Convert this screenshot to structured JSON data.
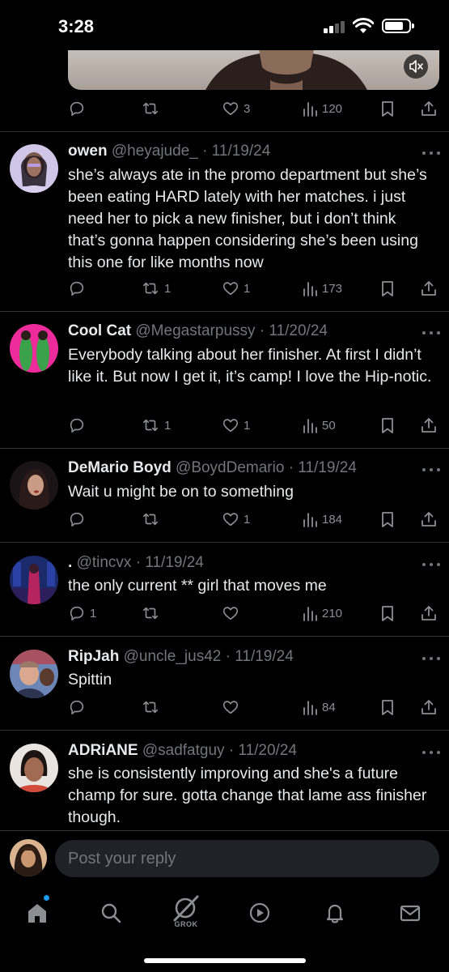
{
  "status_bar": {
    "time": "3:28"
  },
  "top_tweet": {
    "likes": "3",
    "views": "120"
  },
  "tweets": [
    {
      "name": "owen",
      "handle": "@heyajude_",
      "date": "11/19/24",
      "text": "she’s always ate in the promo department but she’s been eating HARD lately with her matches. i just need her to pick a new finisher, but i don’t think that’s gonna happen considering she’s been using this one for like months now",
      "replies": "",
      "reposts": "1",
      "likes": "1",
      "views": "173"
    },
    {
      "name": "Cool Cat",
      "handle": "@Megastarpussy",
      "date": "11/20/24",
      "text": "Everybody talking about her finisher. At first I didn’t like it. But now I get it, it’s camp! I love the Hip-notic.",
      "replies": "",
      "reposts": "1",
      "likes": "1",
      "views": "50"
    },
    {
      "name": "DeMario Boyd",
      "handle": "@BoydDemario",
      "date": "11/19/24",
      "text": "Wait u might be on to something",
      "replies": "",
      "reposts": "",
      "likes": "1",
      "views": "184"
    },
    {
      "name": ".",
      "handle": "@tincvx",
      "date": "11/19/24",
      "text": "the only current ** girl that moves me",
      "replies": "1",
      "reposts": "",
      "likes": "",
      "views": "210"
    },
    {
      "name": "RipJah",
      "handle": "@uncle_jus42",
      "date": "11/19/24",
      "text": "Spittin",
      "replies": "",
      "reposts": "",
      "likes": "",
      "views": "84"
    },
    {
      "name": "ADRiANE",
      "handle": "@sadfatguy",
      "date": "11/20/24",
      "text": "she is consistently improving and she's a future champ for sure. gotta change that lame ass finisher though."
    }
  ],
  "reply_bar": {
    "placeholder": "Post your reply"
  },
  "tab_bar": {
    "grok_label": "GROK"
  },
  "colors": {
    "background": "#000000",
    "muted": "#71767b",
    "accent": "#1d9bf0"
  }
}
